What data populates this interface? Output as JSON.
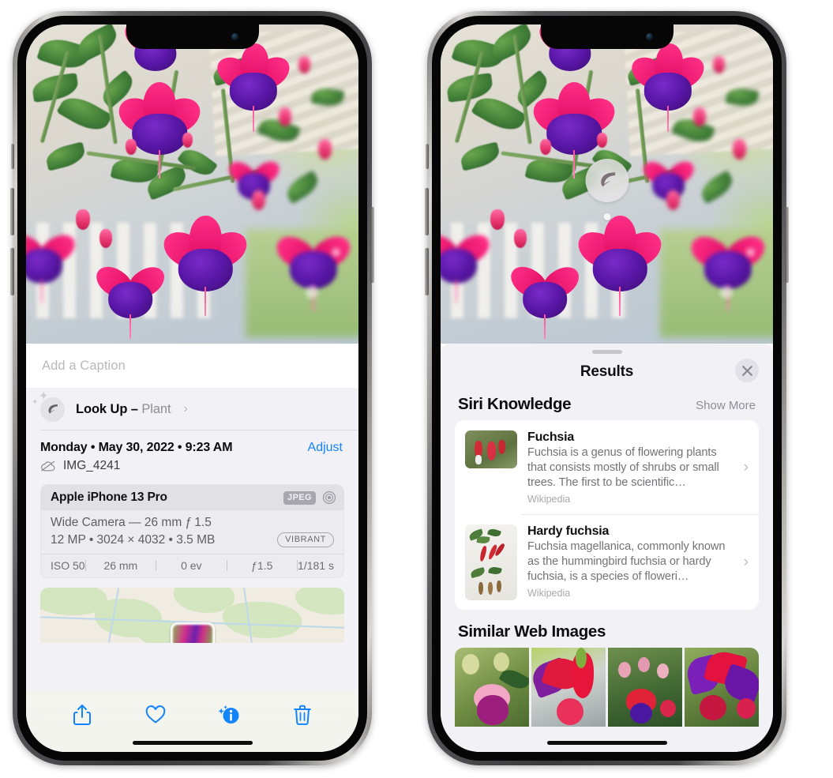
{
  "left_phone": {
    "caption": {
      "placeholder": "Add a Caption",
      "value": ""
    },
    "lookup": {
      "label": "Look Up –",
      "subject": "Plant",
      "chevron": "›",
      "icon": "leaf-icon"
    },
    "date_line": "Monday • May 30, 2022 • 9:23 AM",
    "adjust_label": "Adjust",
    "file_name": "IMG_4241",
    "file_icon": "icloud-slash-icon",
    "camera": {
      "model": "Apple iPhone 13 Pro",
      "format_badge": "JPEG",
      "aperture_icon": "aperture-icon",
      "lens_line": "Wide Camera — 26 mm ƒ 1.5",
      "size_line": "12 MP • 3024 × 4032 • 3.5 MB",
      "style_badge": "VIBRANT",
      "exif": [
        "ISO 50",
        "26 mm",
        "0 ev",
        "ƒ1.5",
        "1/181 s"
      ]
    },
    "toolbar": [
      {
        "name": "share-button",
        "icon": "share-icon"
      },
      {
        "name": "favorite-button",
        "icon": "heart-icon"
      },
      {
        "name": "info-button",
        "icon": "info-sparkle-icon"
      },
      {
        "name": "delete-button",
        "icon": "trash-icon"
      }
    ]
  },
  "right_phone": {
    "badge": {
      "icon": "leaf-icon"
    },
    "sheet": {
      "title": "Results",
      "close_icon": "close-icon"
    },
    "siri_knowledge": {
      "title": "Siri Knowledge",
      "show_more": "Show More",
      "items": [
        {
          "title": "Fuchsia",
          "description": "Fuchsia is a genus of flowering plants that consists mostly of shrubs or small trees. The first to be scientific…",
          "source": "Wikipedia",
          "chevron": "›"
        },
        {
          "title": "Hardy fuchsia",
          "description": "Fuchsia magellanica, commonly known as the hummingbird fuchsia or hardy fuchsia, is a species of floweri…",
          "source": "Wikipedia",
          "chevron": "›"
        }
      ]
    },
    "similar_web_images": {
      "title": "Similar Web Images",
      "count": 4
    }
  },
  "colors": {
    "accent_blue": "#1384fb",
    "sheet_bg": "#f2f1f6",
    "card_bg": "#ffffff",
    "text_primary": "#111114",
    "text_secondary": "#8e8e93"
  }
}
